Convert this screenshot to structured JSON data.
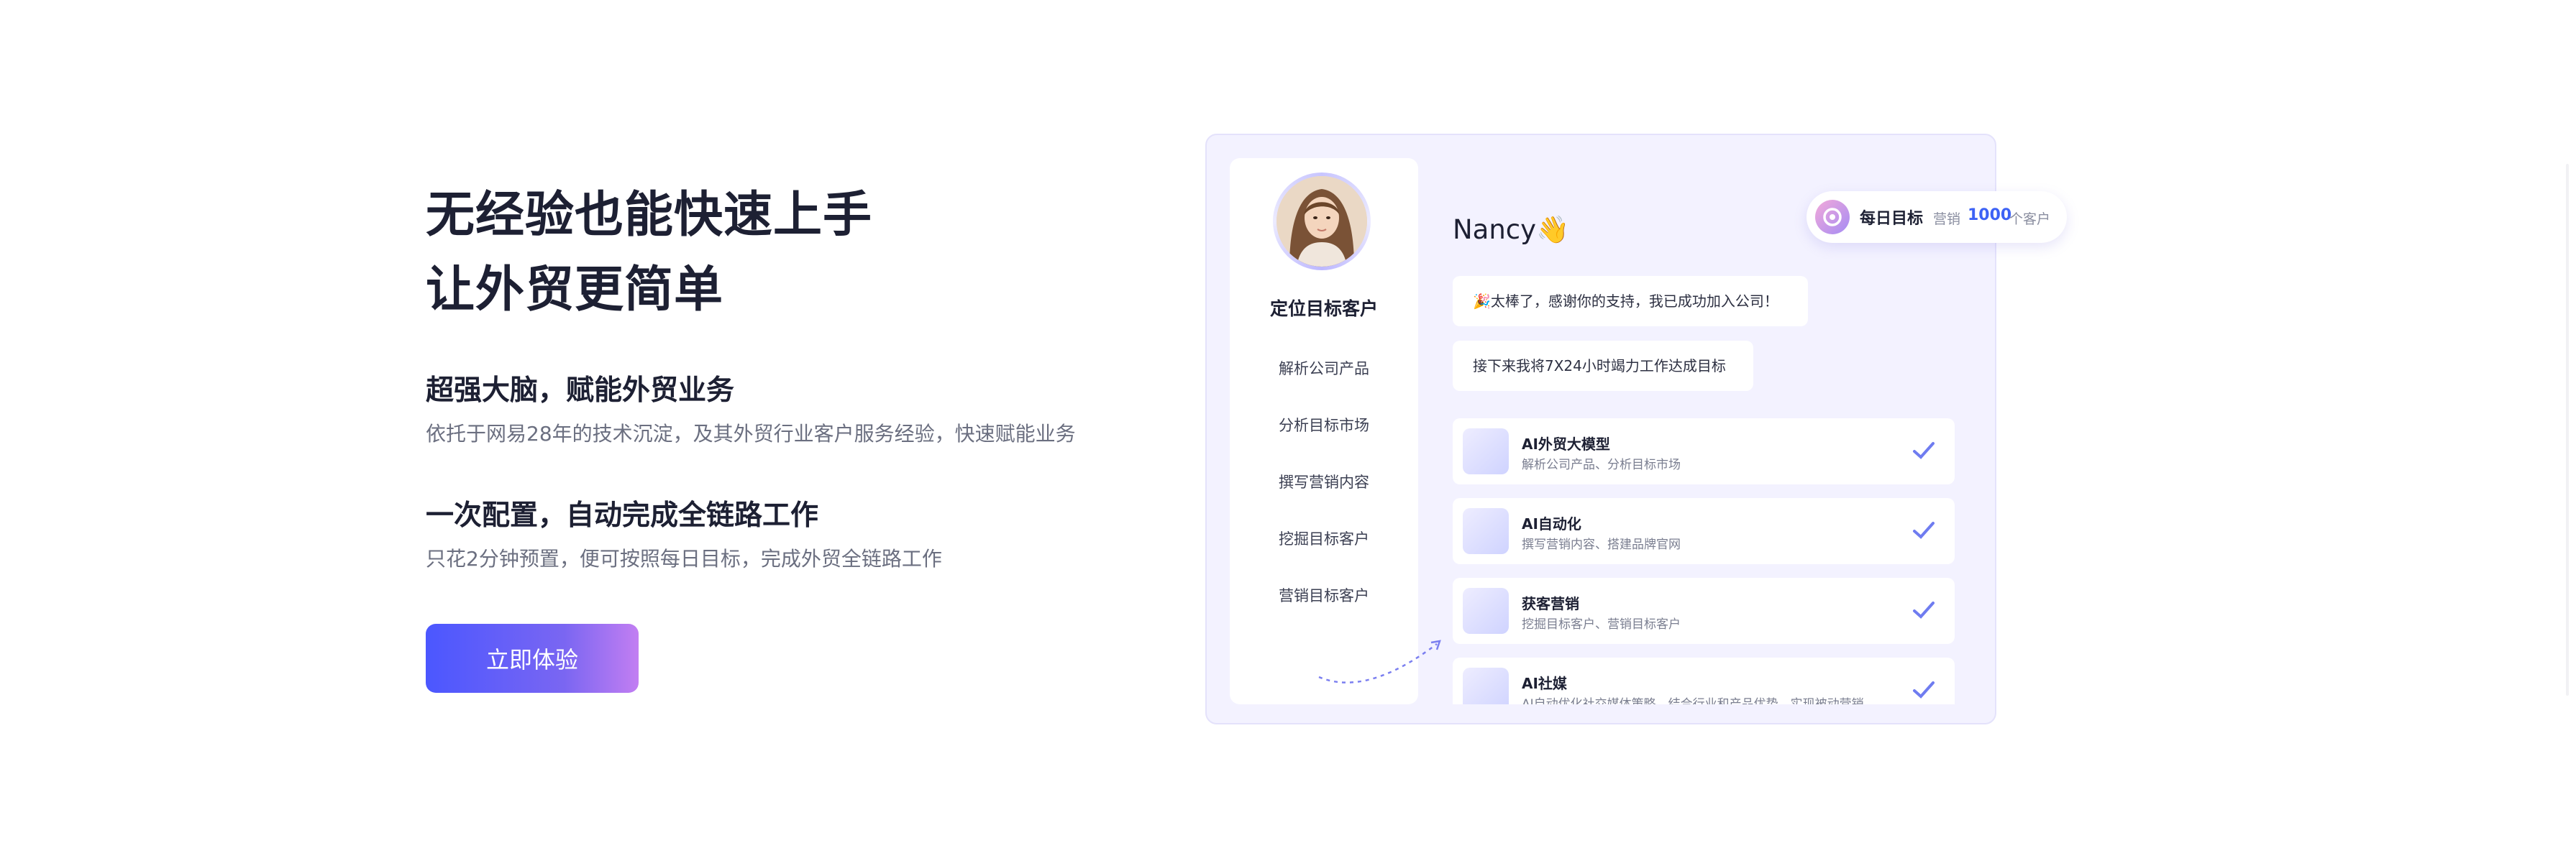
{
  "hero": {
    "title_line1": "无经验也能快速上手",
    "title_line2": "让外贸更简单",
    "feature1_title": "超强大脑，赋能外贸业务",
    "feature1_desc": "依托于网易28年的技术沉淀，及其外贸行业客户服务经验，快速赋能业务",
    "feature2_title": "一次配置，自动完成全链路工作",
    "feature2_desc": "只花2分钟预置，便可按照每日目标，完成外贸全链路工作",
    "cta_label": "立即体验"
  },
  "panel": {
    "title": "定位目标客户",
    "items": [
      "解析公司产品",
      "分析目标市场",
      "撰写营销内容",
      "挖掘目标客户",
      "营销目标客户"
    ]
  },
  "chat": {
    "greeting": "Nancy👋",
    "bubble1": "🎉太棒了，感谢你的支持，我已成功加入公司！",
    "bubble2": "接下来我将7X24小时竭力工作达成目标"
  },
  "goal": {
    "label": "每日目标",
    "sub": "营销",
    "value": "1000",
    "unit": "个客户"
  },
  "tasks": [
    {
      "title": "AI外贸大模型",
      "desc": "解析公司产品、分析目标市场"
    },
    {
      "title": "AI自动化",
      "desc": "撰写营销内容、搭建品牌官网"
    },
    {
      "title": "获客营销",
      "desc": "挖掘目标客户、营销目标客户"
    },
    {
      "title": "AI社媒",
      "desc": "AI自动优化社交媒体策略，结合行业和产品优势，实现被动营销。"
    }
  ],
  "colors": {
    "accent": "#4b57ff",
    "check": "#6f7cf0",
    "card_bg": "#f3f2ff"
  },
  "icons": {
    "check": "check-icon",
    "goal": "target-icon",
    "avatar": "user-avatar"
  }
}
